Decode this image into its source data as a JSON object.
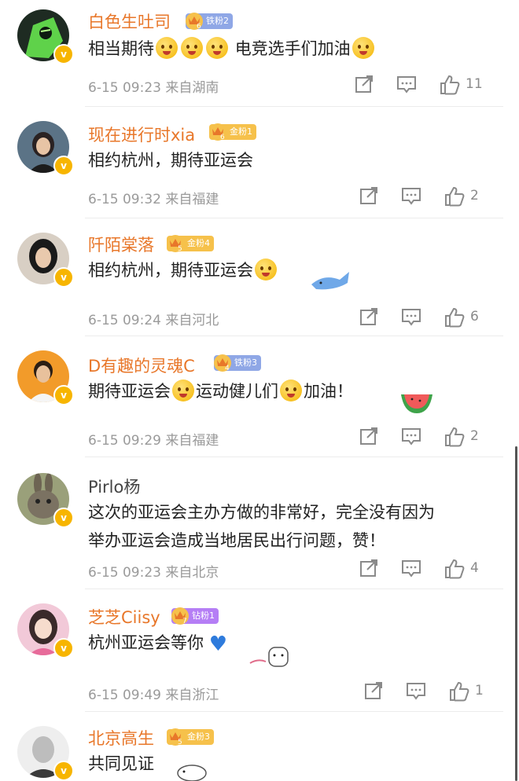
{
  "comments": [
    {
      "name": "白色生吐司",
      "badge": {
        "label": "铁粉2",
        "level": "6",
        "color": "#8fa7e6"
      },
      "text_parts": [
        "相当期待",
        "电竞选手们加油"
      ],
      "time": "6-15 09:23",
      "location": "来自湖南",
      "likes": "11",
      "avatar_icon": "robot-avatar"
    },
    {
      "name": "现在进行时xia",
      "badge": {
        "label": "金粉1",
        "level": "6",
        "color": "#f6c14b"
      },
      "text_parts": [
        "相约杭州，期待亚运会"
      ],
      "time": "6-15 09:32",
      "location": "来自福建",
      "likes": "2",
      "avatar_icon": "girl-avatar"
    },
    {
      "name": "阡陌棠落",
      "badge": {
        "label": "金粉4",
        "level": "5",
        "color": "#f6c14b"
      },
      "text_parts": [
        "相约杭州，期待亚运会"
      ],
      "time": "6-15 09:24",
      "location": "来自河北",
      "likes": "6",
      "avatar_icon": "woman-avatar"
    },
    {
      "name": "D有趣的灵魂C",
      "badge": {
        "label": "铁粉3",
        "level": "4",
        "color": "#8fa7e6"
      },
      "text_parts": [
        "期待亚运会",
        "运动健儿们",
        "加油！"
      ],
      "time": "6-15 09:29",
      "location": "来自福建",
      "likes": "2",
      "avatar_icon": "man-avatar"
    },
    {
      "name": "Pirlo杨",
      "badge": null,
      "text_parts": [
        "这次的亚运会主办方做的非常好，完全没有因为",
        "举办亚运会造成当地居民出行问题，赞！"
      ],
      "time": "6-15 09:23",
      "location": "来自北京",
      "likes": "4",
      "avatar_icon": "rabbit-avatar"
    },
    {
      "name": "芝芝Ciisy",
      "badge": {
        "label": "钻粉1",
        "level": "7",
        "color": "#b57ef5"
      },
      "text_parts": [
        "杭州亚运会等你"
      ],
      "time": "6-15 09:49",
      "location": "来自浙江",
      "likes": "1",
      "avatar_icon": "girl-pink-avatar"
    },
    {
      "name": "北京高生",
      "badge": {
        "label": "金粉3",
        "level": "5",
        "color": "#f6c14b"
      },
      "text_parts": [
        "共同见证"
      ],
      "time": "",
      "location": "",
      "likes": "",
      "avatar_icon": "monk-avatar"
    }
  ],
  "icons": {
    "share": "share-icon",
    "reply": "comment-icon",
    "like": "thumbs-up-icon"
  }
}
